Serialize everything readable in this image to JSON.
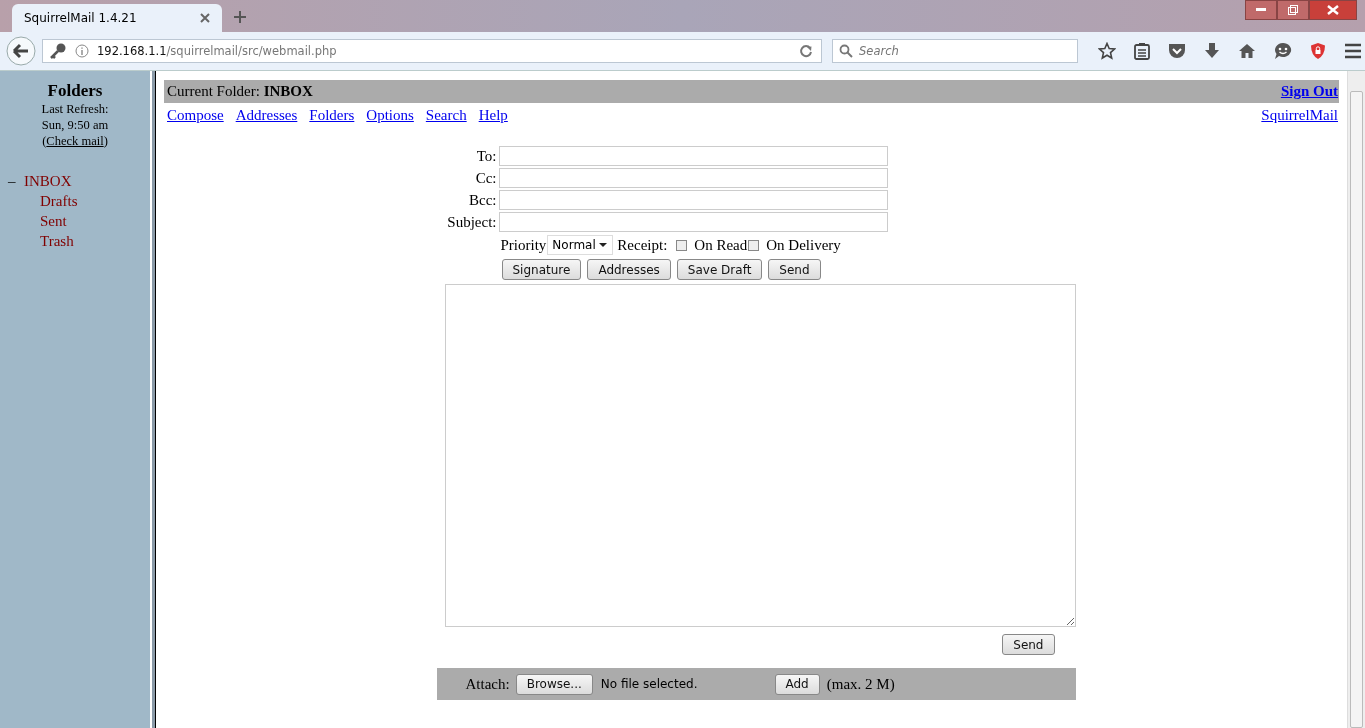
{
  "browser": {
    "tab_title": "SquirrelMail 1.4.21",
    "url_host": "192.168.1.1",
    "url_path": "/squirrelmail/src/webmail.php",
    "search_placeholder": "Search"
  },
  "sidebar": {
    "title": "Folders",
    "last_refresh_label": "Last Refresh:",
    "refresh_time": "Sun, 9:50 am",
    "check_mail_open": "(",
    "check_mail": "Check mail",
    "check_mail_close": ")",
    "folders": [
      {
        "name": "INBOX",
        "toggle": "–",
        "children": [
          {
            "name": "Drafts"
          },
          {
            "name": "Sent"
          },
          {
            "name": "Trash"
          }
        ]
      }
    ]
  },
  "header": {
    "current_folder_label": "Current Folder:",
    "current_folder": "INBOX",
    "sign_out": "Sign Out"
  },
  "nav_links": [
    "Compose",
    "Addresses",
    "Folders",
    "Options",
    "Search",
    "Help"
  ],
  "brand_link": "SquirrelMail",
  "fields": [
    {
      "label": "To:"
    },
    {
      "label": "Cc:"
    },
    {
      "label": "Bcc:"
    },
    {
      "label": "Subject:"
    }
  ],
  "priority": {
    "label": "Priority",
    "value": "Normal"
  },
  "receipt": {
    "label": "Receipt:",
    "options": [
      {
        "label": "On Read",
        "checked": false
      },
      {
        "label": "On Delivery",
        "checked": false
      }
    ]
  },
  "buttons": [
    "Signature",
    "Addresses",
    "Save Draft",
    "Send"
  ],
  "bottom_send": "Send",
  "attach": {
    "label": "Attach:",
    "browse": "Browse...",
    "file_status": "No file selected.",
    "add": "Add",
    "limit": "(max. 2 M)"
  }
}
